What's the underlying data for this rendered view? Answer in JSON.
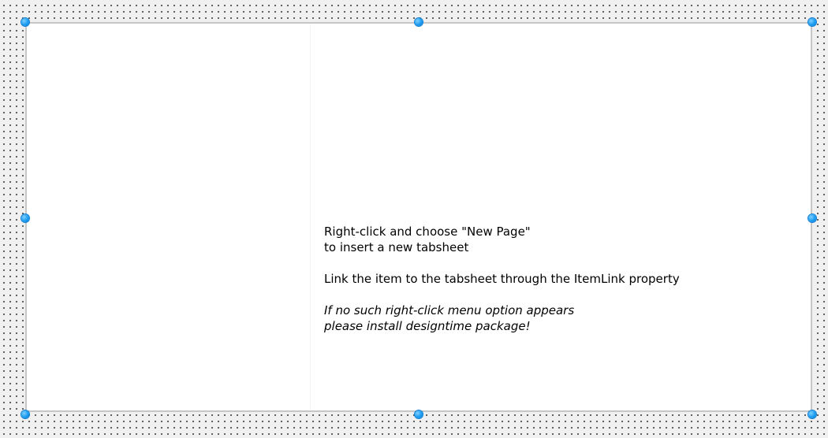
{
  "designer": {
    "panel": {
      "hint_line_1": "Right-click and choose \"New Page\"",
      "hint_line_2": "to insert a new tabsheet",
      "hint_line_3": "Link the item to the tabsheet through the ItemLink property",
      "warning_line_1": "If no such right-click menu option appears",
      "warning_line_2": "please install designtime package!"
    },
    "handle_color": "#1a9bf0",
    "border_color": "#c6c6c6",
    "grid_dot_color": "#3c3c3c",
    "canvas_color": "#f0f0f0"
  }
}
